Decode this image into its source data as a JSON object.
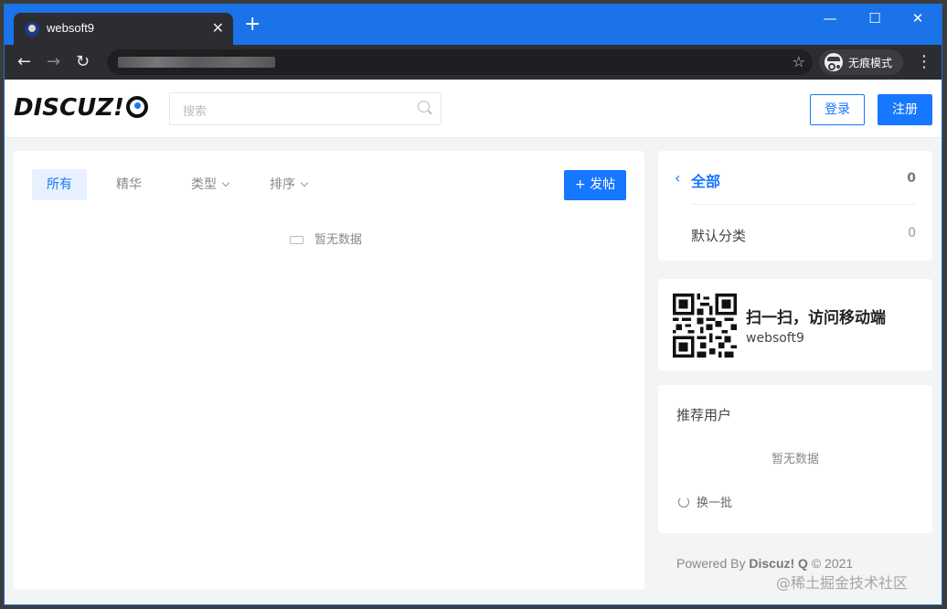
{
  "browser": {
    "tab_title": "websoft9",
    "tab_close": "✕",
    "new_tab": "+",
    "incognito_label": "无痕模式",
    "window_controls": [
      "—",
      "☐",
      "✕"
    ]
  },
  "site": {
    "logo_text": "DISCUZ!",
    "search_placeholder": "搜索",
    "login_label": "登录",
    "register_label": "注册"
  },
  "main": {
    "filters": [
      {
        "label": "所有"
      },
      {
        "label": "精华"
      },
      {
        "label": "类型"
      },
      {
        "label": "排序"
      }
    ],
    "post_button": "+ 发帖",
    "empty_text": "暂无数据"
  },
  "categories": {
    "all_label": "全部",
    "all_count": "0",
    "items": [
      {
        "name": "默认分类",
        "count": "0"
      }
    ]
  },
  "qr_card": {
    "title": "扫一扫，访问移动端",
    "subtitle": "websoft9"
  },
  "recommended": {
    "title": "推荐用户",
    "empty_text": "暂无数据",
    "refresh_label": "换一批"
  },
  "footer": {
    "prefix": "Powered By",
    "brand": "Discuz! Q",
    "suffix": "© 2021"
  },
  "watermark": "@稀土掘金技术社区",
  "colors": {
    "accent": "#1677ff",
    "titlebar": "#1a73e8",
    "toolbar": "#2b2d31"
  }
}
